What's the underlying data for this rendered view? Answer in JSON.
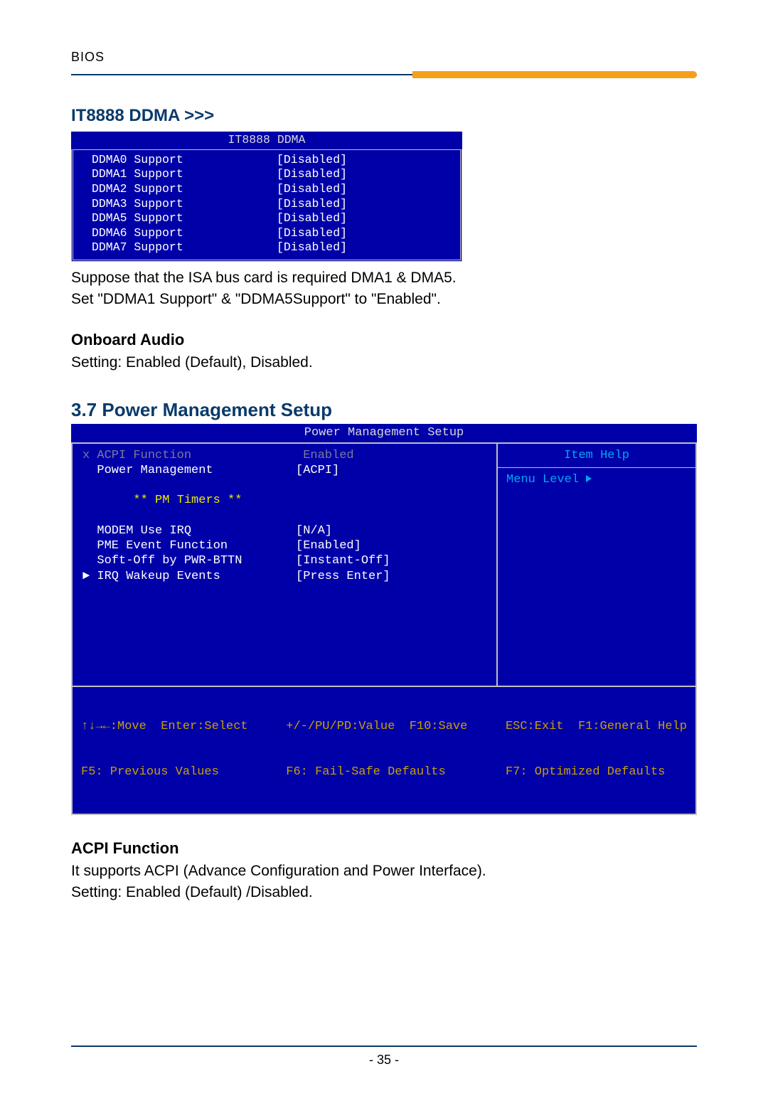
{
  "header": {
    "label": "BIOS"
  },
  "sec1": {
    "title": "IT8888 DDMA >>>",
    "bios_title": "IT8888 DDMA",
    "rows": [
      {
        "label": "DDMA0 Support",
        "value": "[Disabled]"
      },
      {
        "label": "DDMA1 Support",
        "value": "[Disabled]"
      },
      {
        "label": "DDMA2 Support",
        "value": "[Disabled]"
      },
      {
        "label": "DDMA3 Support",
        "value": "[Disabled]"
      },
      {
        "label": "DDMA5 Support",
        "value": "[Disabled]"
      },
      {
        "label": "DDMA6 Support",
        "value": "[Disabled]"
      },
      {
        "label": "DDMA7 Support",
        "value": "[Disabled]"
      }
    ],
    "note1": "Suppose that the ISA bus card is required DMA1 & DMA5.",
    "note2": "Set \"DDMA1 Support\" & \"DDMA5Support\" to \"Enabled\"."
  },
  "sec2": {
    "title": "Onboard Audio",
    "text": "Setting: Enabled (Default), Disabled."
  },
  "sec3": {
    "title": "3.7 Power Management Setup",
    "bios_title": "Power Management Setup",
    "left_rows": [
      {
        "prefix": "x ",
        "label": "ACPI Function",
        "value": " Enabled",
        "cls": "grey"
      },
      {
        "prefix": "  ",
        "label": "Power Management",
        "value": "[ACPI]",
        "cls": "white"
      },
      {
        "prefix": "",
        "label": "",
        "value": "",
        "cls": "white"
      },
      {
        "prefix": "       ",
        "label": "** PM Timers **",
        "value": "",
        "cls": "yellow"
      },
      {
        "prefix": "",
        "label": "",
        "value": "",
        "cls": "white"
      },
      {
        "prefix": "  ",
        "label": "MODEM Use IRQ",
        "value": "[N/A]",
        "cls": "white"
      },
      {
        "prefix": "  ",
        "label": "PME Event Function",
        "value": "[Enabled]",
        "cls": "white"
      },
      {
        "prefix": "  ",
        "label": "Soft-Off by PWR-BTTN",
        "value": "[Instant-Off]",
        "cls": "white"
      },
      {
        "prefix": "► ",
        "label": "IRQ Wakeup Events",
        "value": "[Press Enter]",
        "cls": "white"
      }
    ],
    "right_head": "Item Help",
    "right_menu": "Menu Level   ",
    "footer": {
      "c1a": "↑↓→←:Move  Enter:Select",
      "c1b": "F5: Previous Values",
      "c2a": "+/-/PU/PD:Value  F10:Save",
      "c2b": "F6: Fail-Safe Defaults",
      "c3a": "ESC:Exit  F1:General Help",
      "c3b": "F7: Optimized Defaults"
    }
  },
  "sec4": {
    "title": "ACPI Function",
    "line1": "It supports ACPI (Advance Configuration and Power Interface).",
    "line2": "Setting: Enabled (Default) /Disabled."
  },
  "page_num": "- 35 -"
}
